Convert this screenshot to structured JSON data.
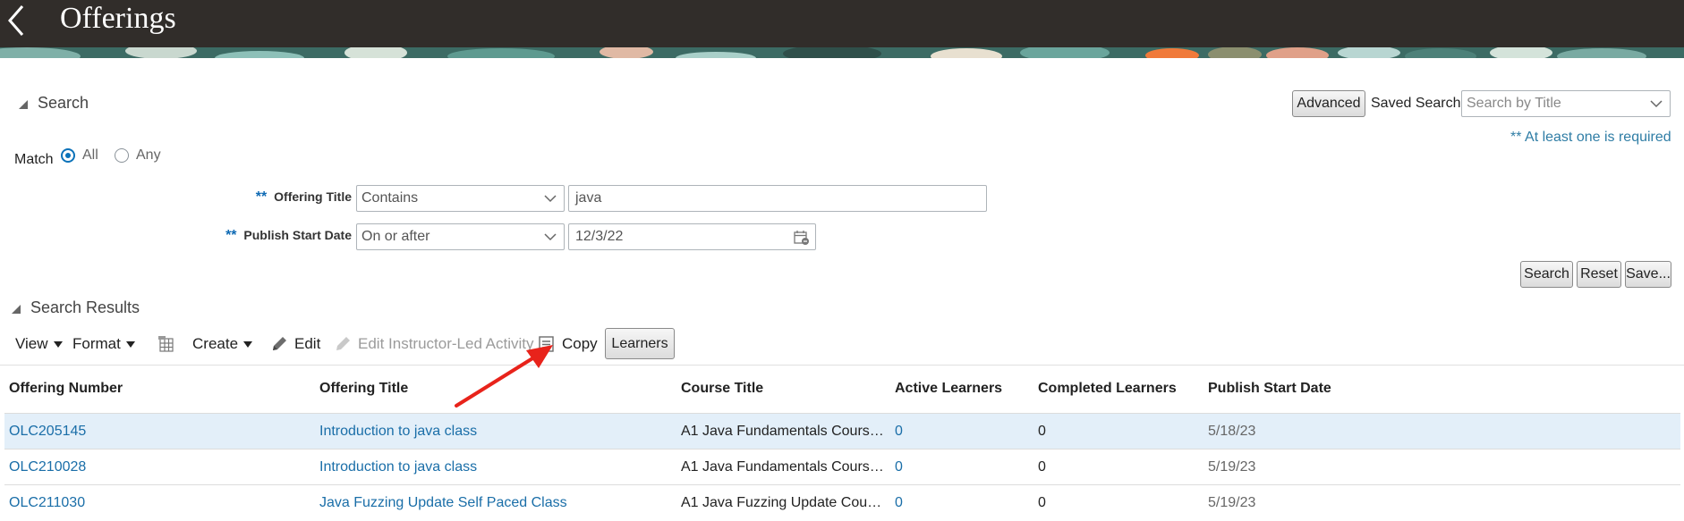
{
  "header": {
    "title": "Offerings"
  },
  "search": {
    "section_title": "Search",
    "advanced_label": "Advanced",
    "saved_search_label": "Saved Search",
    "saved_search_placeholder": "Search by Title",
    "required_note": "** At least one is required",
    "match_label": "Match",
    "match_options": [
      "All",
      "Any"
    ],
    "match_selected": "All",
    "required_marker": "**",
    "fields": [
      {
        "label": "Offering Title",
        "operator": "Contains",
        "value": "java"
      },
      {
        "label": "Publish Start Date",
        "operator": "On or after",
        "value": "12/3/22"
      }
    ],
    "buttons": {
      "search": "Search",
      "reset": "Reset",
      "save": "Save..."
    }
  },
  "results": {
    "section_title": "Search Results",
    "toolbar": {
      "view": "View",
      "format": "Format",
      "create": "Create",
      "edit": "Edit",
      "edit_ila": "Edit Instructor-Led Activity",
      "copy": "Copy",
      "learners": "Learners"
    },
    "columns": [
      "Offering Number",
      "Offering Title",
      "Course Title",
      "Active Learners",
      "Completed Learners",
      "Publish Start Date"
    ],
    "rows": [
      {
        "number": "OLC205145",
        "title": "Introduction to java class",
        "course": "A1 Java Fundamentals Cours…",
        "active": "0",
        "completed": "0",
        "date": "5/18/23"
      },
      {
        "number": "OLC210028",
        "title": "Introduction to java class",
        "course": "A1 Java Fundamentals Cours…",
        "active": "0",
        "completed": "0",
        "date": "5/19/23"
      },
      {
        "number": "OLC211030",
        "title": "Java Fuzzing Update Self Paced Class",
        "course": "A1 Java Fuzzing Update Cou…",
        "active": "0",
        "completed": "0",
        "date": "5/19/23"
      }
    ]
  },
  "colors": {
    "header_bg": "#312d2a",
    "link": "#1a6ea8",
    "selected_row": "#e3eff9",
    "annotation_arrow": "#e8231b"
  }
}
